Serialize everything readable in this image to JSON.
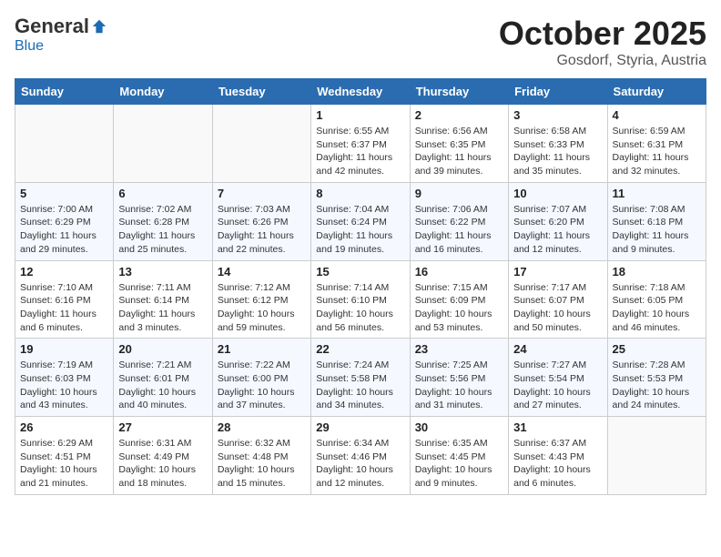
{
  "header": {
    "logo_general": "General",
    "logo_blue": "Blue",
    "month_title": "October 2025",
    "location": "Gosdorf, Styria, Austria"
  },
  "weekdays": [
    "Sunday",
    "Monday",
    "Tuesday",
    "Wednesday",
    "Thursday",
    "Friday",
    "Saturday"
  ],
  "weeks": [
    [
      {
        "day": "",
        "sunrise": "",
        "sunset": "",
        "daylight": ""
      },
      {
        "day": "",
        "sunrise": "",
        "sunset": "",
        "daylight": ""
      },
      {
        "day": "",
        "sunrise": "",
        "sunset": "",
        "daylight": ""
      },
      {
        "day": "1",
        "sunrise": "Sunrise: 6:55 AM",
        "sunset": "Sunset: 6:37 PM",
        "daylight": "Daylight: 11 hours and 42 minutes."
      },
      {
        "day": "2",
        "sunrise": "Sunrise: 6:56 AM",
        "sunset": "Sunset: 6:35 PM",
        "daylight": "Daylight: 11 hours and 39 minutes."
      },
      {
        "day": "3",
        "sunrise": "Sunrise: 6:58 AM",
        "sunset": "Sunset: 6:33 PM",
        "daylight": "Daylight: 11 hours and 35 minutes."
      },
      {
        "day": "4",
        "sunrise": "Sunrise: 6:59 AM",
        "sunset": "Sunset: 6:31 PM",
        "daylight": "Daylight: 11 hours and 32 minutes."
      }
    ],
    [
      {
        "day": "5",
        "sunrise": "Sunrise: 7:00 AM",
        "sunset": "Sunset: 6:29 PM",
        "daylight": "Daylight: 11 hours and 29 minutes."
      },
      {
        "day": "6",
        "sunrise": "Sunrise: 7:02 AM",
        "sunset": "Sunset: 6:28 PM",
        "daylight": "Daylight: 11 hours and 25 minutes."
      },
      {
        "day": "7",
        "sunrise": "Sunrise: 7:03 AM",
        "sunset": "Sunset: 6:26 PM",
        "daylight": "Daylight: 11 hours and 22 minutes."
      },
      {
        "day": "8",
        "sunrise": "Sunrise: 7:04 AM",
        "sunset": "Sunset: 6:24 PM",
        "daylight": "Daylight: 11 hours and 19 minutes."
      },
      {
        "day": "9",
        "sunrise": "Sunrise: 7:06 AM",
        "sunset": "Sunset: 6:22 PM",
        "daylight": "Daylight: 11 hours and 16 minutes."
      },
      {
        "day": "10",
        "sunrise": "Sunrise: 7:07 AM",
        "sunset": "Sunset: 6:20 PM",
        "daylight": "Daylight: 11 hours and 12 minutes."
      },
      {
        "day": "11",
        "sunrise": "Sunrise: 7:08 AM",
        "sunset": "Sunset: 6:18 PM",
        "daylight": "Daylight: 11 hours and 9 minutes."
      }
    ],
    [
      {
        "day": "12",
        "sunrise": "Sunrise: 7:10 AM",
        "sunset": "Sunset: 6:16 PM",
        "daylight": "Daylight: 11 hours and 6 minutes."
      },
      {
        "day": "13",
        "sunrise": "Sunrise: 7:11 AM",
        "sunset": "Sunset: 6:14 PM",
        "daylight": "Daylight: 11 hours and 3 minutes."
      },
      {
        "day": "14",
        "sunrise": "Sunrise: 7:12 AM",
        "sunset": "Sunset: 6:12 PM",
        "daylight": "Daylight: 10 hours and 59 minutes."
      },
      {
        "day": "15",
        "sunrise": "Sunrise: 7:14 AM",
        "sunset": "Sunset: 6:10 PM",
        "daylight": "Daylight: 10 hours and 56 minutes."
      },
      {
        "day": "16",
        "sunrise": "Sunrise: 7:15 AM",
        "sunset": "Sunset: 6:09 PM",
        "daylight": "Daylight: 10 hours and 53 minutes."
      },
      {
        "day": "17",
        "sunrise": "Sunrise: 7:17 AM",
        "sunset": "Sunset: 6:07 PM",
        "daylight": "Daylight: 10 hours and 50 minutes."
      },
      {
        "day": "18",
        "sunrise": "Sunrise: 7:18 AM",
        "sunset": "Sunset: 6:05 PM",
        "daylight": "Daylight: 10 hours and 46 minutes."
      }
    ],
    [
      {
        "day": "19",
        "sunrise": "Sunrise: 7:19 AM",
        "sunset": "Sunset: 6:03 PM",
        "daylight": "Daylight: 10 hours and 43 minutes."
      },
      {
        "day": "20",
        "sunrise": "Sunrise: 7:21 AM",
        "sunset": "Sunset: 6:01 PM",
        "daylight": "Daylight: 10 hours and 40 minutes."
      },
      {
        "day": "21",
        "sunrise": "Sunrise: 7:22 AM",
        "sunset": "Sunset: 6:00 PM",
        "daylight": "Daylight: 10 hours and 37 minutes."
      },
      {
        "day": "22",
        "sunrise": "Sunrise: 7:24 AM",
        "sunset": "Sunset: 5:58 PM",
        "daylight": "Daylight: 10 hours and 34 minutes."
      },
      {
        "day": "23",
        "sunrise": "Sunrise: 7:25 AM",
        "sunset": "Sunset: 5:56 PM",
        "daylight": "Daylight: 10 hours and 31 minutes."
      },
      {
        "day": "24",
        "sunrise": "Sunrise: 7:27 AM",
        "sunset": "Sunset: 5:54 PM",
        "daylight": "Daylight: 10 hours and 27 minutes."
      },
      {
        "day": "25",
        "sunrise": "Sunrise: 7:28 AM",
        "sunset": "Sunset: 5:53 PM",
        "daylight": "Daylight: 10 hours and 24 minutes."
      }
    ],
    [
      {
        "day": "26",
        "sunrise": "Sunrise: 6:29 AM",
        "sunset": "Sunset: 4:51 PM",
        "daylight": "Daylight: 10 hours and 21 minutes."
      },
      {
        "day": "27",
        "sunrise": "Sunrise: 6:31 AM",
        "sunset": "Sunset: 4:49 PM",
        "daylight": "Daylight: 10 hours and 18 minutes."
      },
      {
        "day": "28",
        "sunrise": "Sunrise: 6:32 AM",
        "sunset": "Sunset: 4:48 PM",
        "daylight": "Daylight: 10 hours and 15 minutes."
      },
      {
        "day": "29",
        "sunrise": "Sunrise: 6:34 AM",
        "sunset": "Sunset: 4:46 PM",
        "daylight": "Daylight: 10 hours and 12 minutes."
      },
      {
        "day": "30",
        "sunrise": "Sunrise: 6:35 AM",
        "sunset": "Sunset: 4:45 PM",
        "daylight": "Daylight: 10 hours and 9 minutes."
      },
      {
        "day": "31",
        "sunrise": "Sunrise: 6:37 AM",
        "sunset": "Sunset: 4:43 PM",
        "daylight": "Daylight: 10 hours and 6 minutes."
      },
      {
        "day": "",
        "sunrise": "",
        "sunset": "",
        "daylight": ""
      }
    ]
  ]
}
